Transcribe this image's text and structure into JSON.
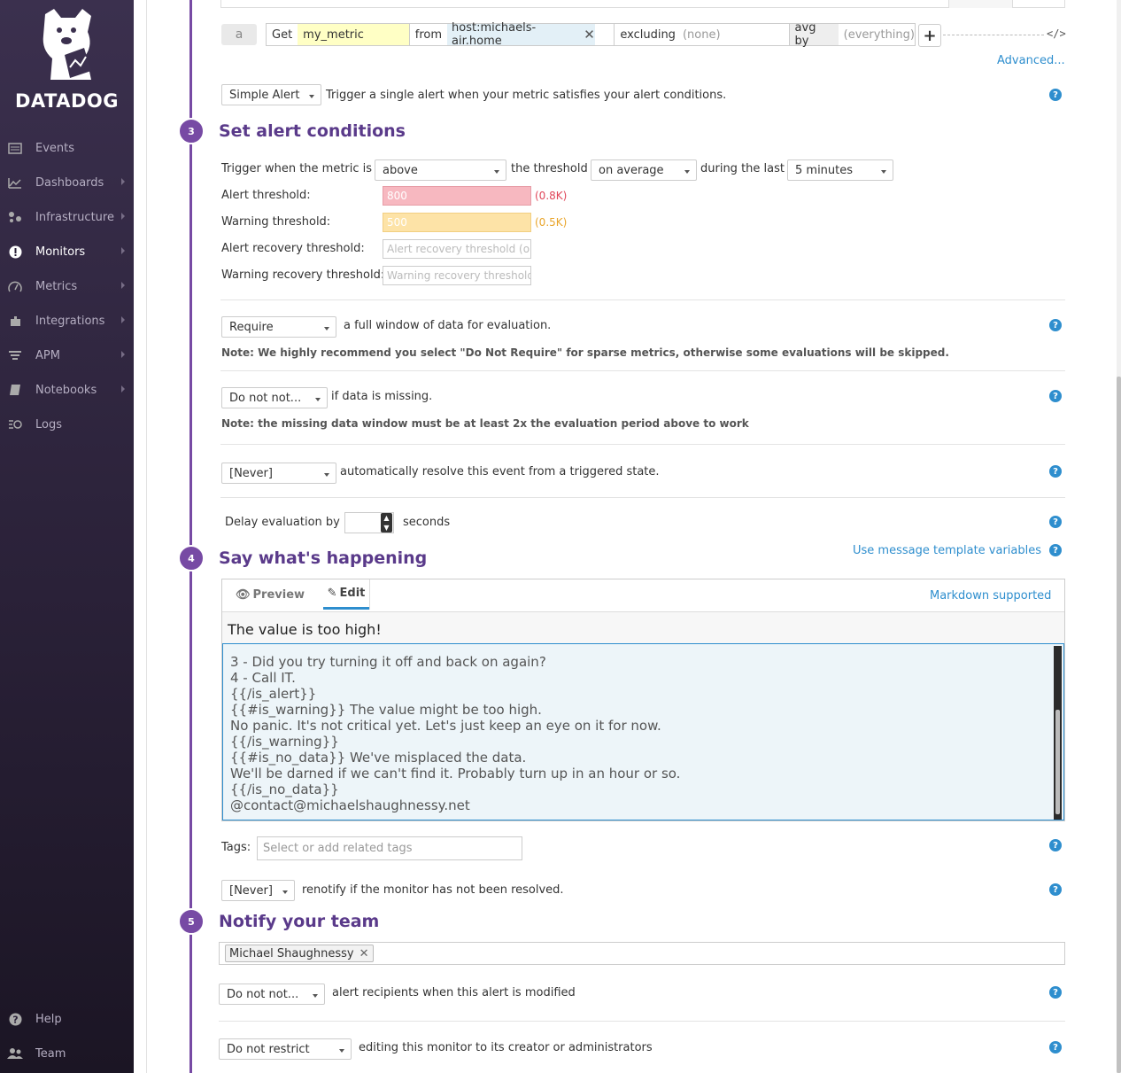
{
  "brand": {
    "name": "DATADOG"
  },
  "nav": [
    {
      "label": "Events",
      "icon": "events-icon",
      "chevron": false
    },
    {
      "label": "Dashboards",
      "icon": "dashboards-icon",
      "chevron": true
    },
    {
      "label": "Infrastructure",
      "icon": "infrastructure-icon",
      "chevron": true
    },
    {
      "label": "Monitors",
      "icon": "monitors-icon",
      "chevron": true,
      "active": true
    },
    {
      "label": "Metrics",
      "icon": "metrics-icon",
      "chevron": true
    },
    {
      "label": "Integrations",
      "icon": "integrations-icon",
      "chevron": true
    },
    {
      "label": "APM",
      "icon": "apm-icon",
      "chevron": true
    },
    {
      "label": "Notebooks",
      "icon": "notebooks-icon",
      "chevron": true
    },
    {
      "label": "Logs",
      "icon": "logs-icon",
      "chevron": false
    }
  ],
  "nav_bottom": [
    {
      "label": "Help",
      "icon": "help-icon"
    },
    {
      "label": "Team",
      "icon": "team-icon"
    }
  ],
  "query": {
    "letter": "a",
    "get_label": "Get",
    "metric": "my_metric",
    "from_label": "from",
    "from_tag": "host:michaels-air.home",
    "excluding_label": "excluding",
    "excluding_value": "(none)",
    "avg_label": "avg by",
    "avg_value": "(everything)",
    "advanced": "Advanced..."
  },
  "alert_type": {
    "value": "Simple Alert",
    "description": "Trigger a single alert when your metric satisfies your alert conditions."
  },
  "step3": {
    "number": "3",
    "title": "Set alert conditions",
    "trigger_prefix": "Trigger when the metric is",
    "comparison": "above",
    "threshold_label": "the threshold",
    "aggregation": "on average",
    "during_label": "during the last",
    "timeframe": "5 minutes",
    "alert_label": "Alert threshold:",
    "alert_value": "800",
    "alert_hint": "(0.8K)",
    "warning_label": "Warning threshold:",
    "warning_value": "500",
    "warning_hint": "(0.5K)",
    "alert_recovery_label": "Alert recovery threshold:",
    "alert_recovery_placeholder": "Alert recovery threshold (optional)",
    "warning_recovery_label": "Warning recovery threshold:",
    "warning_recovery_placeholder": "Warning recovery threshold (optional)",
    "require_value": "Require",
    "require_text": "a full window of data for evaluation.",
    "require_note": "Note: We highly recommend you select \"Do Not Require\" for sparse metrics, otherwise some evaluations will be skipped.",
    "missing_value": "Do not not...",
    "missing_text": "if data is missing.",
    "missing_note": "Note: the missing data window must be at least 2x the evaluation period above to work",
    "resolve_value": "[Never]",
    "resolve_text": "automatically resolve this event from a triggered state.",
    "delay_label": "Delay evaluation by",
    "delay_unit": "seconds"
  },
  "step4": {
    "number": "4",
    "title": "Say what's happening",
    "template_link": "Use message template variables",
    "tab_preview": "Preview",
    "tab_edit": "Edit",
    "markdown": "Markdown supported",
    "subject": "The value is too high!",
    "message_lines": [
      "3 - Did you try turning it off and back on again?",
      "4 - Call IT.",
      "{{/is_alert}}",
      "{{#is_warning}} The value might be too high.",
      "No panic. It's not critical yet. Let's just keep an eye on it for now.",
      "{{/is_warning}}",
      "{{#is_no_data}} We've misplaced the data.",
      "We'll be darned if we can't find it. Probably turn up in an hour or so.",
      "{{/is_no_data}}",
      "@contact@michaelshaughnessy.net"
    ],
    "tags_label": "Tags:",
    "tags_placeholder": "Select or add related tags",
    "renotify_value": "[Never]",
    "renotify_text": "renotify if the monitor has not been resolved."
  },
  "step5": {
    "number": "5",
    "title": "Notify your team",
    "recipient": "Michael Shaughnessy",
    "modified_value": "Do not not...",
    "modified_text": "alert recipients when this alert is modified",
    "restrict_value": "Do not restrict",
    "restrict_text": "editing this monitor to its creator or administrators"
  },
  "colors": {
    "accent": "#774aa4",
    "link": "#2e8ece",
    "alert_bg": "#f7b8c0",
    "warning_bg": "#fde3a7",
    "alert_text": "#e0475a",
    "warning_text": "#e9a52b"
  }
}
